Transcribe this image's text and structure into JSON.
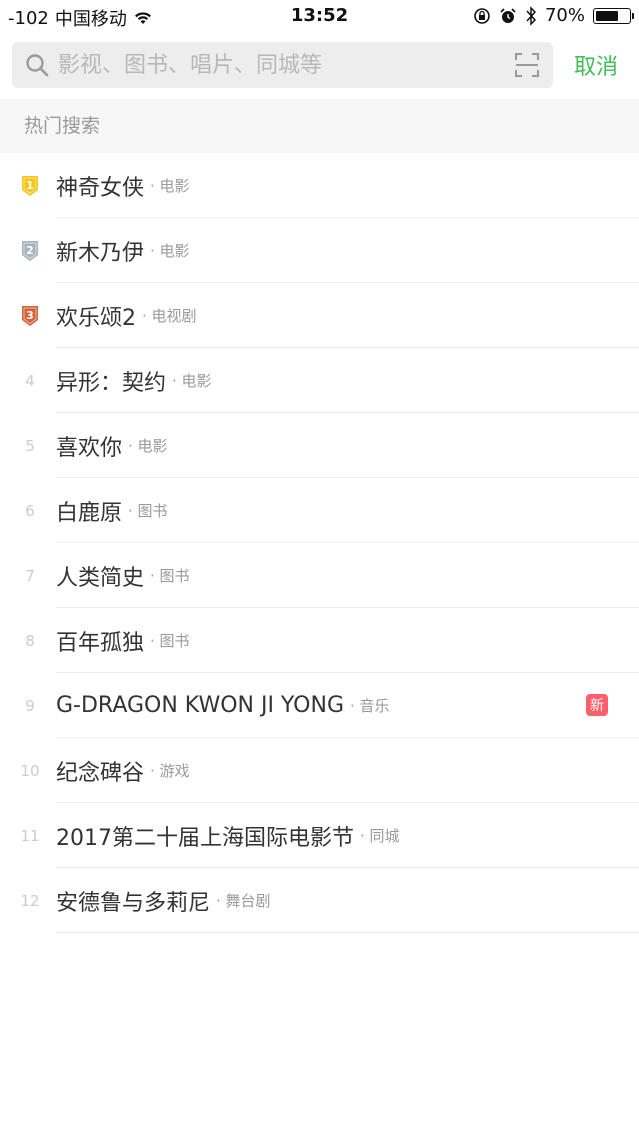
{
  "status_bar": {
    "signal": "-102",
    "carrier": "中国移动",
    "time": "13:52",
    "battery_text": "70%",
    "battery_level": 0.7
  },
  "search": {
    "placeholder": "影视、图书、唱片、同城等",
    "cancel_label": "取消"
  },
  "section": {
    "title": "热门搜索"
  },
  "hot_searches": [
    {
      "rank": "1",
      "title": "神奇女侠",
      "category": "· 电影",
      "badge": "medal-gold"
    },
    {
      "rank": "2",
      "title": "新木乃伊",
      "category": "· 电影",
      "badge": "medal-silver"
    },
    {
      "rank": "3",
      "title": "欢乐颂2",
      "category": "· 电视剧",
      "badge": "medal-bronze"
    },
    {
      "rank": "4",
      "title": "异形：契约",
      "category": "· 电影"
    },
    {
      "rank": "5",
      "title": "喜欢你",
      "category": "· 电影"
    },
    {
      "rank": "6",
      "title": "白鹿原",
      "category": "· 图书"
    },
    {
      "rank": "7",
      "title": "人类简史",
      "category": "· 图书"
    },
    {
      "rank": "8",
      "title": "百年孤独",
      "category": "· 图书"
    },
    {
      "rank": "9",
      "title": "G-DRAGON KWON JI YONG",
      "category": "· 音乐",
      "new_label": "新"
    },
    {
      "rank": "10",
      "title": "纪念碑谷",
      "category": "· 游戏"
    },
    {
      "rank": "11",
      "title": "2017第二十届上海国际电影节",
      "category": "· 同城"
    },
    {
      "rank": "12",
      "title": "安德鲁与多莉尼",
      "category": "· 舞台剧"
    }
  ],
  "colors": {
    "accent": "#42bd56",
    "gold": "#f5c518",
    "silver": "#a9b3bd",
    "bronze": "#d4623b",
    "new_badge": "#ff5f6a"
  }
}
